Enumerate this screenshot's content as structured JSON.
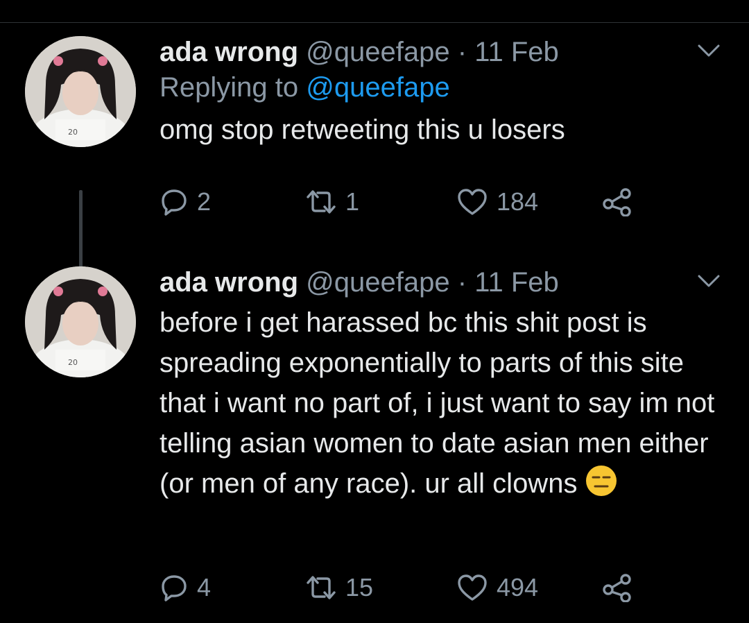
{
  "colors": {
    "background": "#000000",
    "primary_text": "#e7e9ea",
    "secondary_text": "#8b98a5",
    "link": "#1d9bf0",
    "thread_line": "#3a3f44"
  },
  "tweets": [
    {
      "name": "ada wrong",
      "handle": "@queefape",
      "separator": "·",
      "date": "11 Feb",
      "replying_prefix": "Replying to",
      "replying_to": "@queefape",
      "text": "omg stop retweeting this u losers",
      "emoji": "",
      "replies": "2",
      "retweets": "1",
      "likes": "184",
      "icons": [
        "reply-icon",
        "retweet-icon",
        "like-icon",
        "share-icon",
        "caret-down-icon"
      ]
    },
    {
      "name": "ada wrong",
      "handle": "@queefape",
      "separator": "·",
      "date": "11 Feb",
      "text": "before i get harassed bc this shit post is spreading exponentially to parts of this site that i want no part of, i just want to say im not telling asian women to date asian men either (or men of any race). ur all clowns",
      "emoji": "expressionless-face",
      "replies": "4",
      "retweets": "15",
      "likes": "494",
      "icons": [
        "reply-icon",
        "retweet-icon",
        "like-icon",
        "share-icon",
        "caret-down-icon"
      ]
    }
  ]
}
